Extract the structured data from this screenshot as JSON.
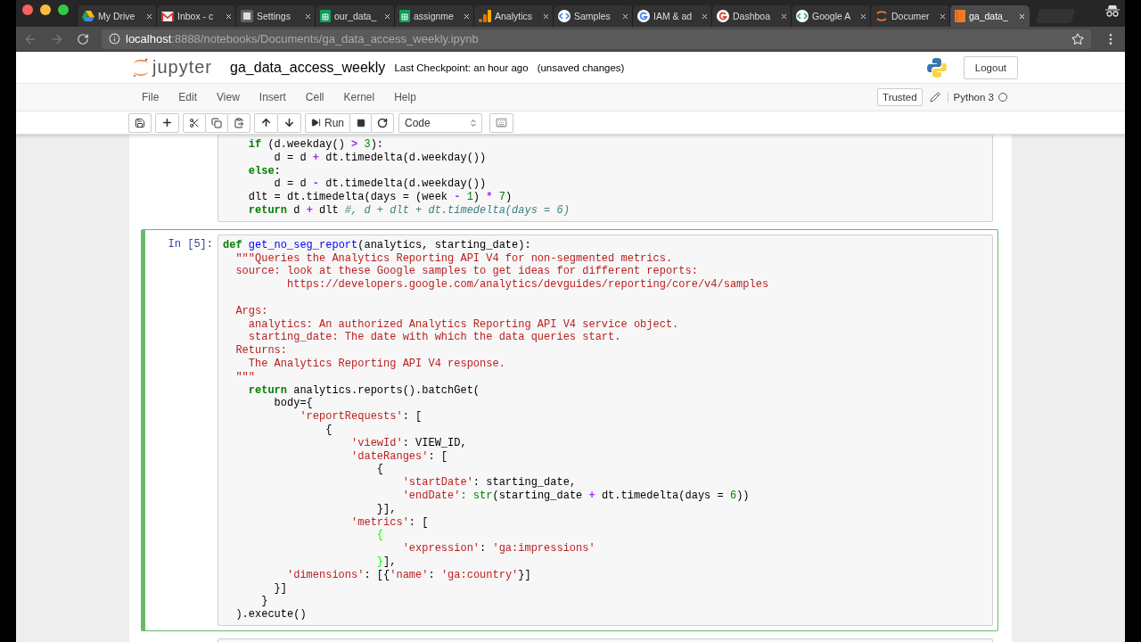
{
  "browser": {
    "tabs": [
      {
        "label": "My Drive",
        "selected": false
      },
      {
        "label": "Inbox - c",
        "selected": false
      },
      {
        "label": "Settings",
        "selected": false
      },
      {
        "label": "our_data_",
        "selected": false
      },
      {
        "label": "assignme",
        "selected": false
      },
      {
        "label": "Analytics",
        "selected": false
      },
      {
        "label": "Samples",
        "selected": false
      },
      {
        "label": "IAM & ad",
        "selected": false
      },
      {
        "label": "Dashboa",
        "selected": false
      },
      {
        "label": "Google A",
        "selected": false
      },
      {
        "label": "Documer",
        "selected": false
      },
      {
        "label": "ga_data_",
        "selected": true
      }
    ],
    "url": {
      "host": "localhost",
      "path": ":8888/notebooks/Documents/ga_data_access_weekly.ipynb"
    }
  },
  "header": {
    "logo_text": "jupyter",
    "notebook_name": "ga_data_access_weekly",
    "checkpoint": "Last Checkpoint: an hour ago",
    "autosave_status": "(unsaved changes)",
    "logout": "Logout"
  },
  "menu": {
    "items": [
      "File",
      "Edit",
      "View",
      "Insert",
      "Cell",
      "Kernel",
      "Help"
    ],
    "trusted": "Trusted",
    "kernel_name": "Python 3"
  },
  "toolbar": {
    "run_label": "Run",
    "cell_type": "Code"
  },
  "cells": [
    {
      "selected": false,
      "lines": [
        {
          "kind": "code",
          "tokens": [
            {
              "text": "    if",
              "kind": "kw"
            },
            {
              "text": " (d.weekday() ",
              "kind": "p"
            },
            {
              "text": ">",
              "kind": "op"
            },
            {
              "text": " 3",
              "kind": "num"
            },
            {
              "text": "):",
              "kind": "p"
            }
          ]
        },
        {
          "kind": "code",
          "tokens": [
            {
              "text": "        d = d ",
              "kind": "p"
            },
            {
              "text": "+",
              "kind": "op"
            },
            {
              "text": " dt.timedelta(d.weekday())",
              "kind": "p"
            }
          ]
        },
        {
          "kind": "code",
          "tokens": [
            {
              "text": "    else",
              "kind": "kw"
            },
            {
              "text": ":",
              "kind": "p"
            }
          ]
        },
        {
          "kind": "code",
          "tokens": [
            {
              "text": "        d = d ",
              "kind": "p"
            },
            {
              "text": "-",
              "kind": "op"
            },
            {
              "text": " dt.timedelta(d.weekday())",
              "kind": "p"
            }
          ]
        },
        {
          "kind": "code",
          "tokens": [
            {
              "text": "    dlt = dt.timedelta(days = (week ",
              "kind": "p"
            },
            {
              "text": "-",
              "kind": "op"
            },
            {
              "text": " 1",
              "kind": "num"
            },
            {
              "text": ") ",
              "kind": "p"
            },
            {
              "text": "*",
              "kind": "op"
            },
            {
              "text": " 7",
              "kind": "num"
            },
            {
              "text": ")",
              "kind": "p"
            }
          ]
        },
        {
          "kind": "code",
          "tokens": [
            {
              "text": "    return",
              "kind": "kw"
            },
            {
              "text": " d ",
              "kind": "p"
            },
            {
              "text": "+",
              "kind": "op"
            },
            {
              "text": " dlt ",
              "kind": "p"
            },
            {
              "text": "#, d + dlt + dt.timedelta(days = 6)",
              "kind": "cm"
            }
          ]
        }
      ]
    },
    {
      "prompt": "In [5]:",
      "selected": true,
      "lines": [
        {
          "kind": "code",
          "tokens": [
            {
              "text": "def",
              "kind": "kw"
            },
            {
              "text": " get_no_seg_report",
              "kind": "fn"
            },
            {
              "text": "(analytics, starting_date):",
              "kind": "p"
            }
          ]
        },
        {
          "kind": "code",
          "tokens": [
            {
              "text": "  \"\"\"Queries the Analytics Reporting API V4 for non-segmented metrics.",
              "kind": "doc"
            }
          ]
        },
        {
          "kind": "code",
          "tokens": [
            {
              "text": "  source: look at these Google samples to get ideas for different reports:",
              "kind": "doc"
            }
          ]
        },
        {
          "kind": "code",
          "tokens": [
            {
              "text": "          https://developers.google.com/analytics/devguides/reporting/core/v4/samples",
              "kind": "doc"
            }
          ]
        },
        {
          "kind": "blank"
        },
        {
          "kind": "code",
          "tokens": [
            {
              "text": "  Args:",
              "kind": "doc"
            }
          ]
        },
        {
          "kind": "code",
          "tokens": [
            {
              "text": "    analytics: An authorized Analytics Reporting API V4 service object.",
              "kind": "doc"
            }
          ]
        },
        {
          "kind": "code",
          "tokens": [
            {
              "text": "    starting_date: The date with which the data queries start.",
              "kind": "doc"
            }
          ]
        },
        {
          "kind": "code",
          "tokens": [
            {
              "text": "  Returns:",
              "kind": "doc"
            }
          ]
        },
        {
          "kind": "code",
          "tokens": [
            {
              "text": "    The Analytics Reporting API V4 response.",
              "kind": "doc"
            }
          ]
        },
        {
          "kind": "code",
          "tokens": [
            {
              "text": "  \"\"\"",
              "kind": "doc"
            }
          ]
        },
        {
          "kind": "code",
          "tokens": [
            {
              "text": "    return",
              "kind": "kw"
            },
            {
              "text": " analytics.reports().batchGet(",
              "kind": "p"
            }
          ]
        },
        {
          "kind": "code",
          "tokens": [
            {
              "text": "        body={",
              "kind": "p"
            }
          ]
        },
        {
          "kind": "code",
          "tokens": [
            {
              "text": "            'reportRequests'",
              "kind": "str"
            },
            {
              "text": ": [",
              "kind": "p"
            }
          ]
        },
        {
          "kind": "code",
          "tokens": [
            {
              "text": "                {",
              "kind": "p"
            }
          ]
        },
        {
          "kind": "code",
          "tokens": [
            {
              "text": "                    'viewId'",
              "kind": "str"
            },
            {
              "text": ": VIEW_ID,",
              "kind": "p"
            }
          ]
        },
        {
          "kind": "code",
          "tokens": [
            {
              "text": "                    'dateRanges'",
              "kind": "str"
            },
            {
              "text": ": [",
              "kind": "p"
            }
          ]
        },
        {
          "kind": "code",
          "tokens": [
            {
              "text": "                        {",
              "kind": "p"
            }
          ]
        },
        {
          "kind": "code",
          "tokens": [
            {
              "text": "                            'startDate'",
              "kind": "str"
            },
            {
              "text": ": starting_date,",
              "kind": "p"
            }
          ]
        },
        {
          "kind": "code",
          "tokens": [
            {
              "text": "                            'endDate'",
              "kind": "str"
            },
            {
              "text": ": str",
              "kind": "bi"
            },
            {
              "text": "(starting_date ",
              "kind": "p"
            },
            {
              "text": "+",
              "kind": "op"
            },
            {
              "text": " dt.timedelta(days = ",
              "kind": "p"
            },
            {
              "text": "6",
              "kind": "num"
            },
            {
              "text": "))",
              "kind": "p"
            }
          ]
        },
        {
          "kind": "code",
          "tokens": [
            {
              "text": "                        }],",
              "kind": "p"
            }
          ]
        },
        {
          "kind": "code",
          "tokens": [
            {
              "text": "                    'metrics'",
              "kind": "str"
            },
            {
              "text": ": [",
              "kind": "p"
            }
          ]
        },
        {
          "kind": "code",
          "tokens": [
            {
              "text": "                        {",
              "kind": "match"
            }
          ]
        },
        {
          "kind": "code",
          "tokens": [
            {
              "text": "                            'expression'",
              "kind": "str"
            },
            {
              "text": ": ",
              "kind": "p"
            },
            {
              "text": "'ga:impressions'",
              "kind": "str"
            }
          ]
        },
        {
          "kind": "code",
          "tokens": [
            {
              "text": "                        }",
              "kind": "match"
            },
            {
              "text": "],",
              "kind": "p"
            }
          ]
        },
        {
          "kind": "code",
          "tokens": [
            {
              "text": "          'dimensions'",
              "kind": "str"
            },
            {
              "text": ": [{",
              "kind": "p"
            },
            {
              "text": "'name'",
              "kind": "str"
            },
            {
              "text": ": ",
              "kind": "p"
            },
            {
              "text": "'ga:country'",
              "kind": "str"
            },
            {
              "text": "}]",
              "kind": "p"
            }
          ]
        },
        {
          "kind": "code",
          "tokens": [
            {
              "text": "        }]",
              "kind": "p"
            }
          ]
        },
        {
          "kind": "code",
          "tokens": [
            {
              "text": "      }",
              "kind": "p"
            }
          ]
        },
        {
          "kind": "code",
          "tokens": [
            {
              "text": "  ).execute()",
              "kind": "p"
            }
          ]
        }
      ]
    },
    {
      "selected": false
    }
  ]
}
